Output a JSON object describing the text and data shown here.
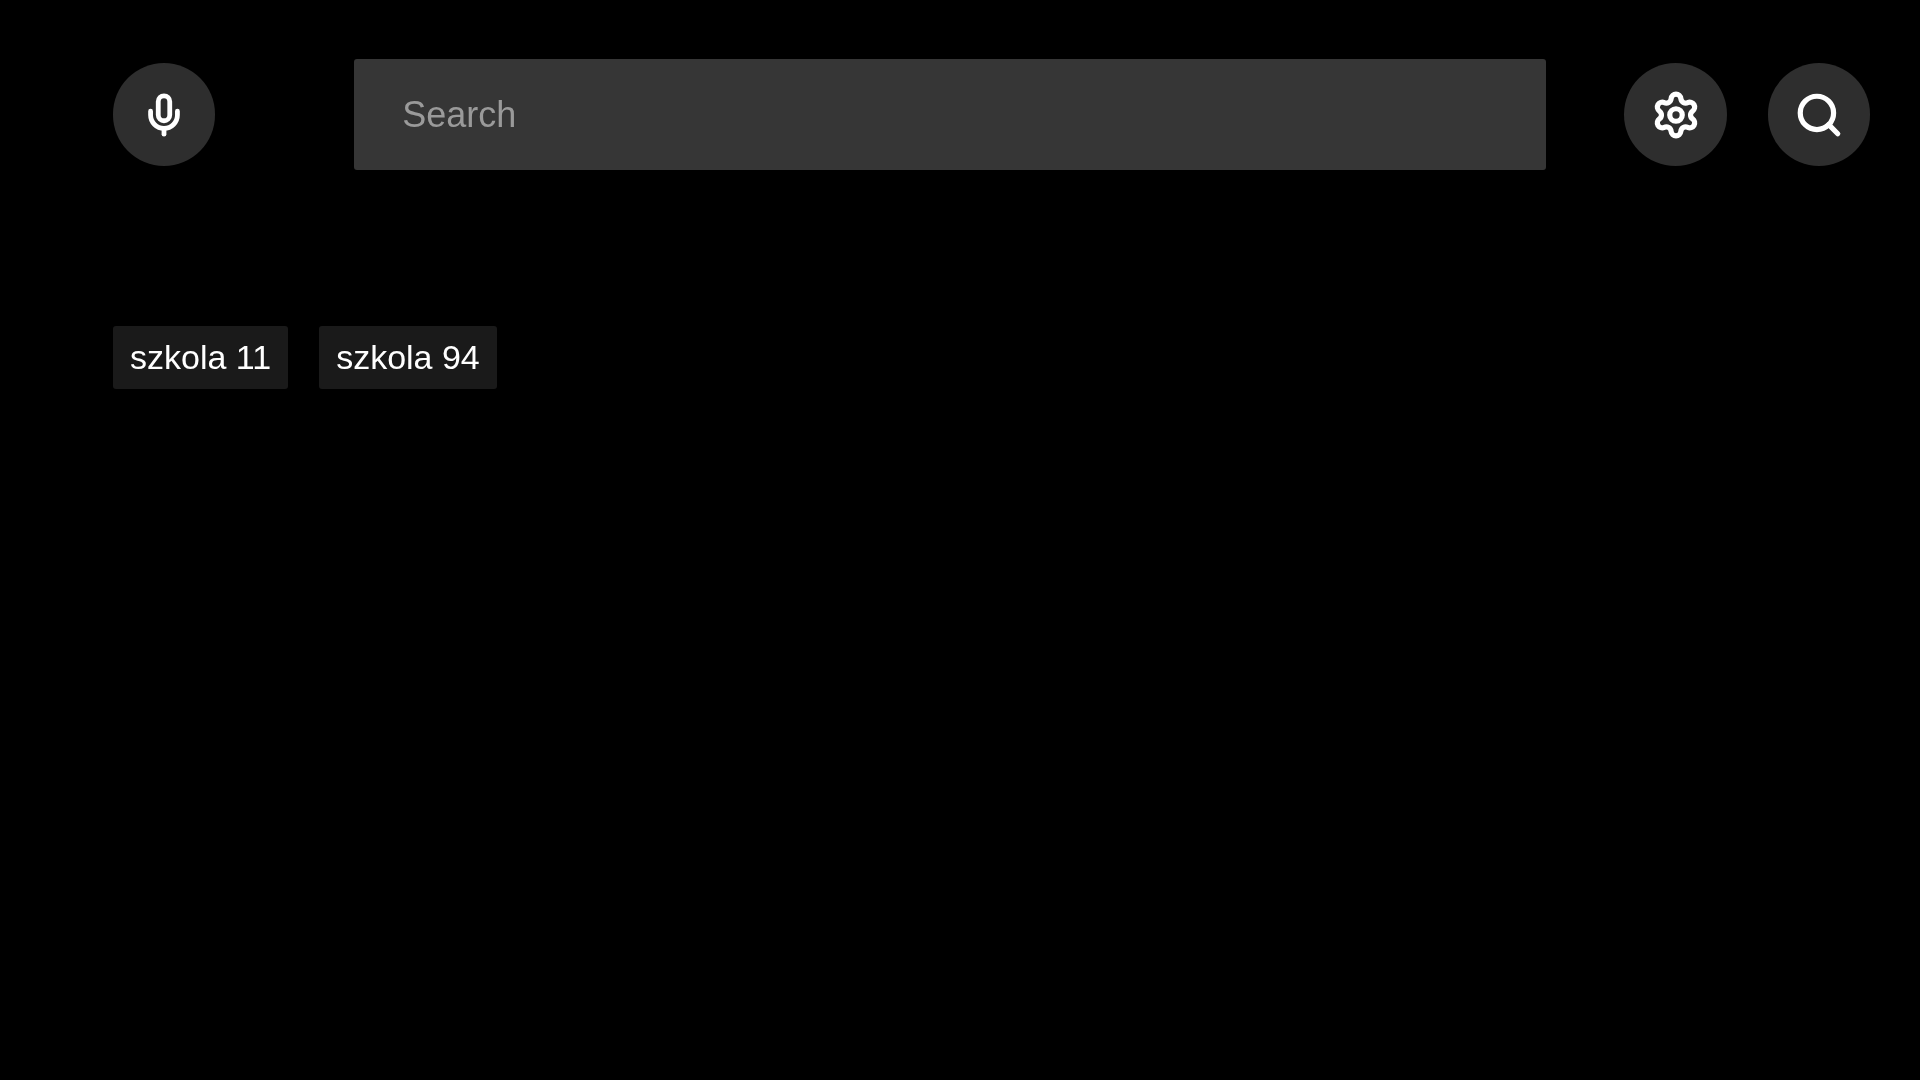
{
  "search": {
    "placeholder": "Search"
  },
  "suggestions": [
    {
      "label": "szkola 11"
    },
    {
      "label": "szkola 94"
    }
  ]
}
